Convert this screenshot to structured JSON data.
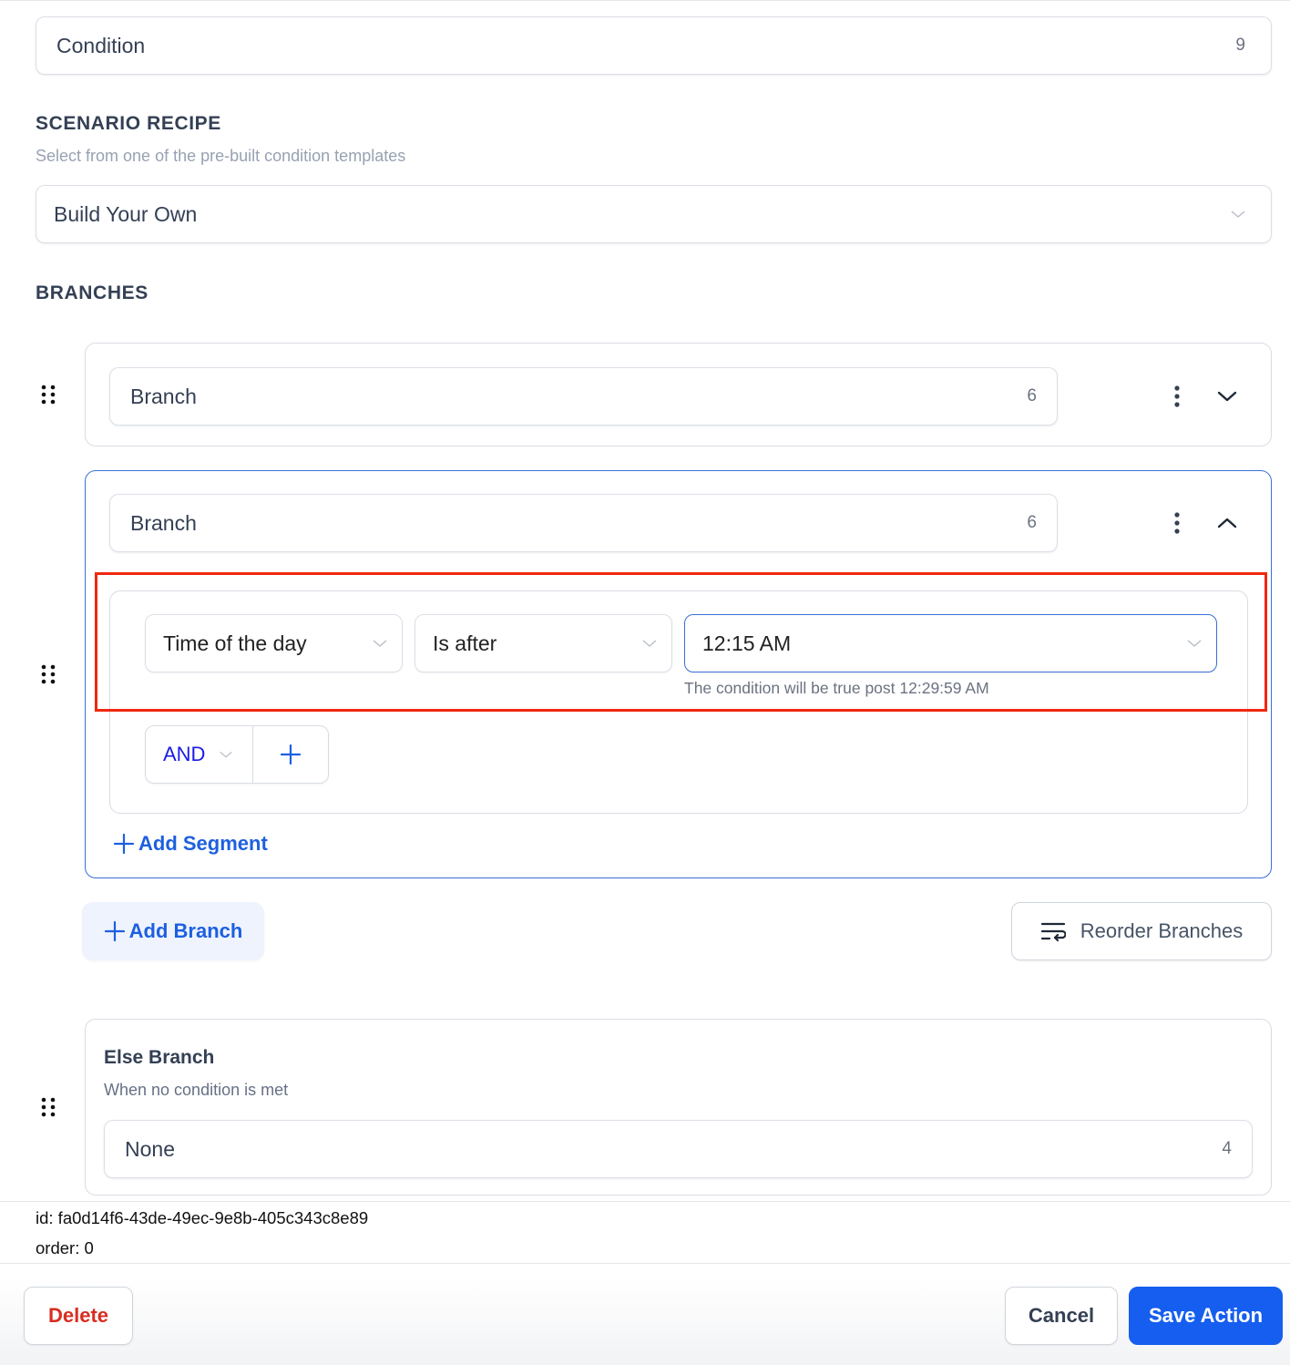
{
  "condition_name": {
    "value": "Condition",
    "char_count": "9"
  },
  "scenario_recipe": {
    "title": "SCENARIO RECIPE",
    "subtitle": "Select from one of the pre-built condition templates",
    "selected": "Build Your Own"
  },
  "branches": {
    "title": "BRANCHES",
    "items": [
      {
        "name": "Branch",
        "char_count": "6",
        "expanded": false
      },
      {
        "name": "Branch",
        "char_count": "6",
        "expanded": true,
        "segment": {
          "field": "Time of the day",
          "operator": "Is after",
          "value": "12:15 AM",
          "hint": "The condition will be true post 12:29:59 AM",
          "connector": "AND"
        },
        "add_segment_label": "Add Segment"
      }
    ],
    "add_branch_label": "Add Branch",
    "reorder_label": "Reorder Branches"
  },
  "else_branch": {
    "title": "Else Branch",
    "subtitle": "When no condition is met",
    "value": "None",
    "char_count": "4"
  },
  "meta": {
    "id_line": "id: fa0d14f6-43de-49ec-9e8b-405c343c8e89",
    "order_line": "order: 0"
  },
  "footer": {
    "delete_label": "Delete",
    "cancel_label": "Cancel",
    "save_label": "Save Action"
  },
  "colors": {
    "accent": "#155eef",
    "link": "#1d5fe0",
    "danger": "#d92d20",
    "highlight": "#f0280f",
    "active_border": "#3b6fd6"
  },
  "icons": {
    "drag": "drag-handle-icon",
    "kebab": "more-vertical-icon",
    "chevron_down": "chevron-down-icon",
    "chevron_up": "chevron-up-icon",
    "plus": "plus-icon",
    "reorder": "reorder-lines-icon"
  }
}
